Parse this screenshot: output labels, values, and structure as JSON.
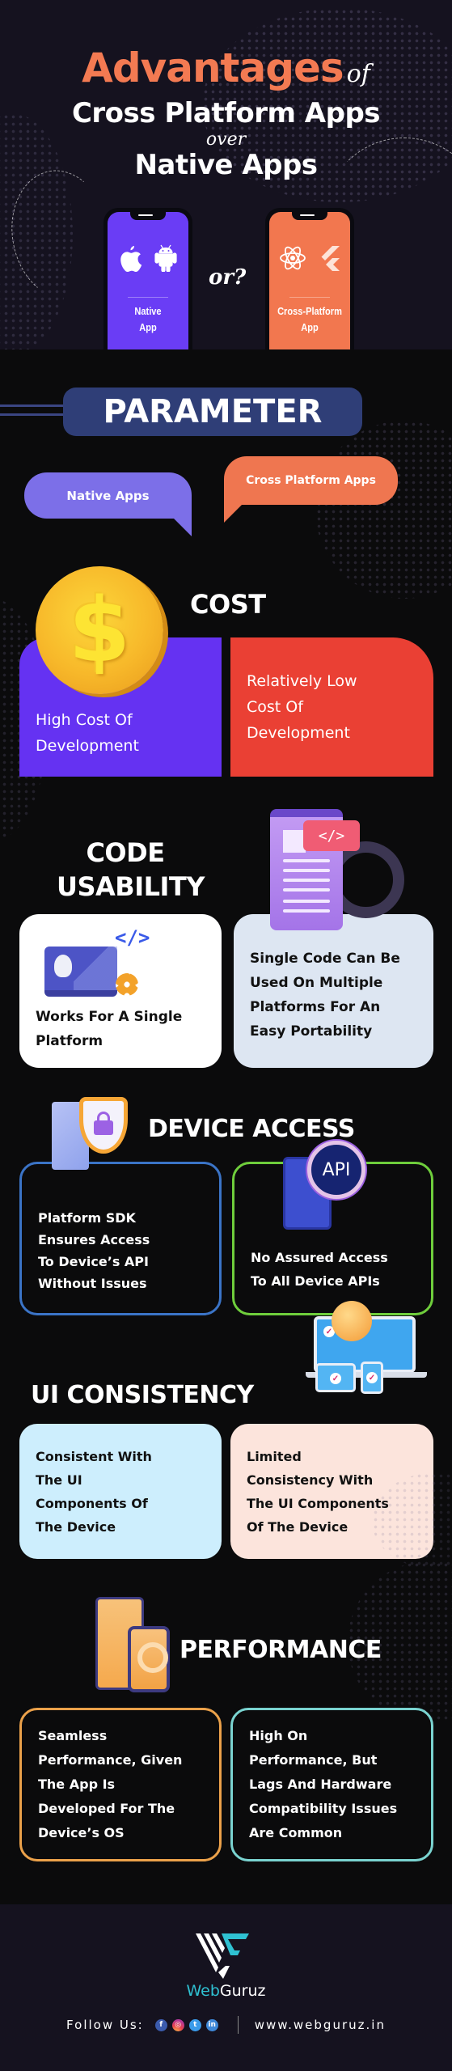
{
  "header": {
    "title_accent": "Advantages",
    "title_of": "of",
    "title_line2": "Cross Platform Apps",
    "title_over": "over",
    "title_line3": "Native Apps",
    "phones": [
      {
        "label_line1": "Native",
        "label_line2": "App",
        "icons": [
          "apple-icon",
          "android-icon"
        ],
        "color": "#6a3df5"
      },
      {
        "label_line1": "Cross-Platform",
        "label_line2": "App",
        "icons": [
          "react-icon",
          "flutter-icon"
        ],
        "color": "#f2774f"
      }
    ],
    "or_text": "or?"
  },
  "parameter": {
    "title": "PARAMETER",
    "columns": [
      {
        "label": "Native Apps",
        "color": "#7c6fe8"
      },
      {
        "label": "Cross Platform Apps",
        "color": "#ef7650"
      }
    ]
  },
  "sections": [
    {
      "title": "COST",
      "icon": "dollar-coin-icon",
      "native": [
        "High Cost Of",
        "Development"
      ],
      "cross": [
        "Relatively Low",
        "Cost Of",
        "Development"
      ]
    },
    {
      "title_line1": "CODE",
      "title_line2": "USABILITY",
      "icon": "code-document-icon",
      "native": [
        "Works For A Single",
        "Platform"
      ],
      "cross": [
        "Single Code Can Be",
        "Used On Multiple",
        "Platforms For An",
        "Easy Portability"
      ],
      "code_tag": "</>"
    },
    {
      "title": "DEVICE ACCESS",
      "icon": "shield-lock-icon",
      "native": [
        "Platform SDK",
        "Ensures Access",
        "To Device’s API",
        "Without Issues"
      ],
      "cross": [
        "No Assured Access",
        "To All Device APIs"
      ],
      "api_label": "API"
    },
    {
      "title": "UI CONSISTENCY",
      "icon": "devices-sync-icon",
      "native": [
        "Consistent With",
        "The UI",
        "Components Of",
        "The Device"
      ],
      "cross": [
        "Limited",
        "Consistency With",
        "The UI Components",
        "Of The Device"
      ]
    },
    {
      "title": "PERFORMANCE",
      "icon": "tablet-chart-icon",
      "native": [
        "Seamless",
        "Performance, Given",
        "The App Is",
        "Developed For The",
        "Device’s OS"
      ],
      "cross": [
        "High On",
        "Performance, But",
        "Lags And Hardware",
        "Compatibility Issues",
        "Are Common"
      ]
    }
  ],
  "footer": {
    "brand_part1": "Web",
    "brand_part2": "Guruz",
    "follow_label": "Follow Us:",
    "social": [
      {
        "name": "facebook",
        "glyph": "f"
      },
      {
        "name": "instagram",
        "glyph": "◎"
      },
      {
        "name": "twitter",
        "glyph": "t"
      },
      {
        "name": "linkedin",
        "glyph": "in"
      }
    ],
    "website": "www.webguruz.in"
  },
  "colors": {
    "accent_orange": "#f37a52",
    "native_purple": "#6532f2",
    "cross_red": "#ea4034",
    "parameter_blue": "#2f3e77",
    "brand_teal": "#2fc1d2"
  }
}
